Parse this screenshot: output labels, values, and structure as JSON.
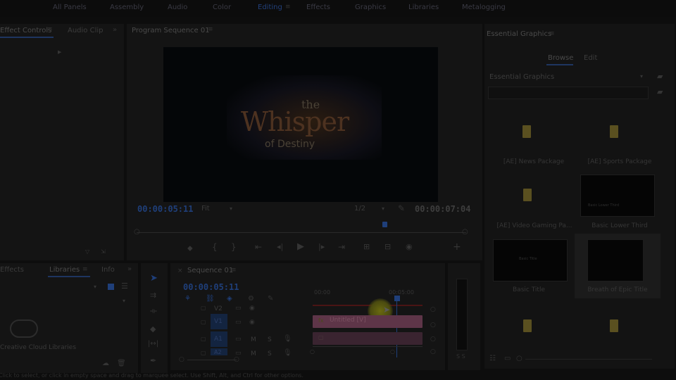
{
  "workspace_tabs": [
    "All Panels",
    "Assembly",
    "Audio",
    "Color",
    "Editing",
    "Effects",
    "Graphics",
    "Libraries",
    "Metalogging"
  ],
  "active_workspace": "Editing",
  "left_panel": {
    "tabs": [
      "Effect Controls",
      "Audio Clip"
    ]
  },
  "program": {
    "title": "Program Sequence 01",
    "video_title_line1": "the",
    "video_title_line2": "Whisper",
    "video_title_line3": "of Destiny",
    "timecode_current": "00:00:05:11",
    "timecode_duration": "00:00:07:04",
    "fit": "Fit",
    "resolution": "1/2"
  },
  "libraries_panel": {
    "tabs": [
      "Effects",
      "Libraries",
      "Info"
    ],
    "cc_label": "Creative Cloud Libraries"
  },
  "sequence": {
    "title": "Sequence 01",
    "timecode": "00:00:05:11",
    "ruler": [
      "00:00",
      "00:05:00"
    ],
    "tracks": [
      {
        "name": "V2",
        "kind": "video"
      },
      {
        "name": "V1",
        "kind": "video"
      },
      {
        "name": "A1",
        "kind": "audio"
      },
      {
        "name": "A2",
        "kind": "audio"
      }
    ],
    "clip_label": "Untitled [V]",
    "mute": "M",
    "solo": "S"
  },
  "essential_graphics": {
    "title": "Essential Graphics",
    "tabs": [
      "Browse",
      "Edit"
    ],
    "dropdown": "Essential Graphics",
    "search_value": "",
    "items": [
      {
        "label": "[AE] News Package",
        "kind": "folder"
      },
      {
        "label": "[AE] Sports Package",
        "kind": "folder"
      },
      {
        "label": "[AE] Video Gaming Pa...",
        "kind": "folder"
      },
      {
        "label": "Basic Lower Third",
        "kind": "thumb",
        "inner": "Basic Lower Third"
      },
      {
        "label": "Basic Title",
        "kind": "thumb",
        "inner": "Basic Title"
      },
      {
        "label": "Breath of Epic Title",
        "kind": "thumb",
        "inner": ""
      },
      {
        "label": "",
        "kind": "folder"
      },
      {
        "label": "",
        "kind": "folder"
      }
    ]
  },
  "status_bar": "Click to select, or click in empty space and drag to marquee select. Use Shift, Alt, and Ctrl for other options.",
  "colors": {
    "accent": "#1f3f7a",
    "clip_pink": "#6a3a4a",
    "highlight": "#5a5a12"
  }
}
